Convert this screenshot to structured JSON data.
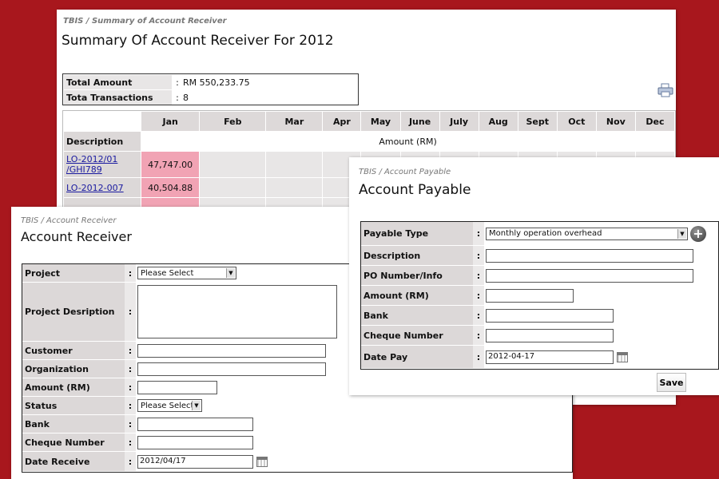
{
  "summary": {
    "breadcrumb": "TBIS / Summary of Account Receiver",
    "title": "Summary Of Account Receiver For 2012",
    "total_amount_label": "Total Amount",
    "total_amount_value": "RM 550,233.75",
    "total_tx_label": "Tota Transactions",
    "total_tx_value": "8",
    "months": [
      "Jan",
      "Feb",
      "Mar",
      "Apr",
      "May",
      "June",
      "July",
      "Aug",
      "Sept",
      "Oct",
      "Nov",
      "Dec"
    ],
    "description_label": "Description",
    "amount_header": "Amount (RM)",
    "rows": [
      {
        "desc": "LO-2012/01 /GHI789",
        "jan": "47,747.00"
      },
      {
        "desc": "LO-2012-007",
        "jan": "40,504.88"
      }
    ]
  },
  "receiver": {
    "breadcrumb": "TBIS / Account Receiver",
    "title": "Account Receiver",
    "project_label": "Project",
    "project_value": "Please Select",
    "project_desc_label": "Project Desription",
    "customer_label": "Customer",
    "organization_label": "Organization",
    "amount_label": "Amount (RM)",
    "status_label": "Status",
    "status_value": "Please Select",
    "bank_label": "Bank",
    "cheque_label": "Cheque Number",
    "date_label": "Date Receive",
    "date_value": "2012/04/17"
  },
  "payable": {
    "breadcrumb": "TBIS / Account Payable",
    "title": "Account Payable",
    "type_label": "Payable Type",
    "type_value": "Monthly operation overhead",
    "description_label": "Description",
    "po_label": "PO Number/Info",
    "amount_label": "Amount (RM)",
    "bank_label": "Bank",
    "cheque_label": "Cheque Number",
    "date_label": "Date Pay",
    "date_value": "2012-04-17",
    "save_label": "Save"
  },
  "colon": ":",
  "icons": [
    "printer-icon",
    "calendar-icon",
    "add-icon",
    "dropdown-arrow-icon"
  ],
  "colors": {
    "background": "#a8171d",
    "highlight": "#f1a3b4",
    "label_bg": "#dcd8d8"
  }
}
